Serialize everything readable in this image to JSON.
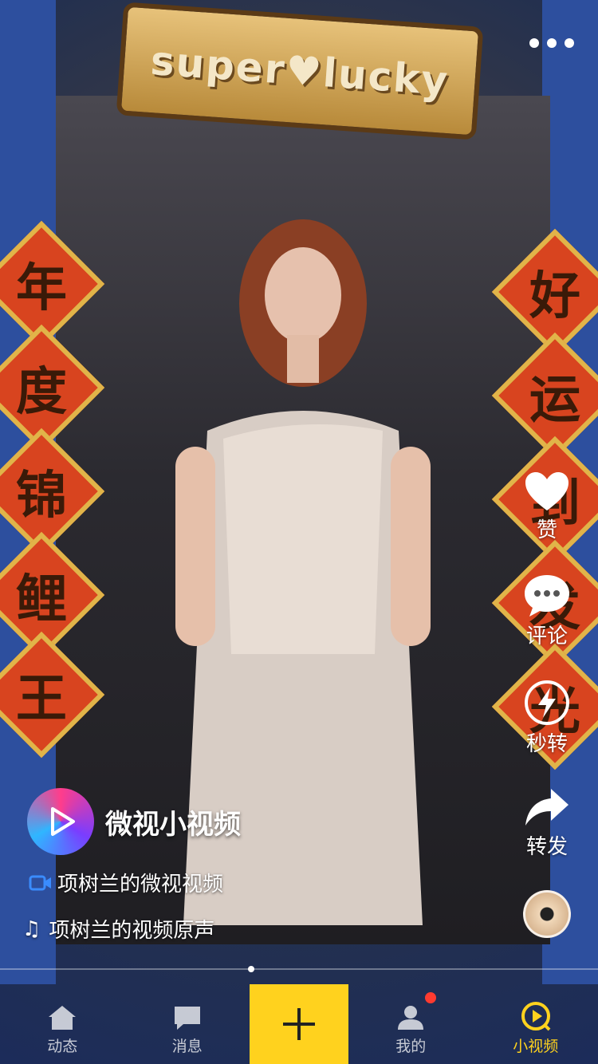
{
  "banner": {
    "text": "super♥lucky"
  },
  "couplet_left": [
    "年",
    "度",
    "锦",
    "鲤",
    "王"
  ],
  "couplet_right": [
    "好",
    "运",
    "到",
    "发",
    "光"
  ],
  "actions": {
    "like_label": "赞",
    "comment_label": "评论",
    "quick_share_label": "秒转",
    "forward_label": "转发"
  },
  "author": {
    "name": "微视小视频"
  },
  "video": {
    "title": "项树兰的微视视频",
    "music": "项树兰的视频原声",
    "progress": 0.42
  },
  "tabbar": {
    "tabs": [
      {
        "label": "动态",
        "icon": "home-icon"
      },
      {
        "label": "消息",
        "icon": "message-icon"
      },
      {
        "label": "我的",
        "icon": "user-icon"
      },
      {
        "label": "小视频",
        "icon": "play-icon"
      }
    ],
    "active_tab": "小视频"
  },
  "colors": {
    "accent": "#ffd21e",
    "badge": "#ff3b30"
  }
}
